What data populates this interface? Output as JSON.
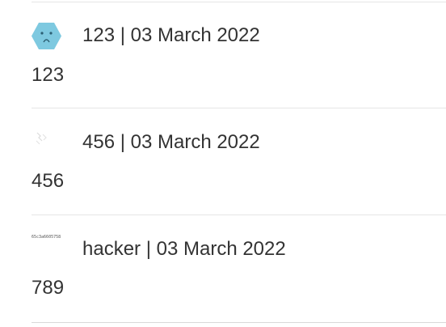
{
  "comments": [
    {
      "author": "123",
      "separator": " | ",
      "date": "03 March 2022",
      "text": "123",
      "avatar_icon": "hexagon-face-avatar-icon"
    },
    {
      "author": "456",
      "separator": " | ",
      "date": "03 March 2022",
      "text": "456",
      "avatar_icon": "broken-image-icon"
    },
    {
      "author": "hacker",
      "separator": " | ",
      "date": "03 March 2022",
      "text": "789",
      "avatar_alt": "65c3a6605758"
    }
  ],
  "colors": {
    "avatar_fill": "#7ec9e0",
    "text": "#333333",
    "divider": "#e6e6e6"
  }
}
